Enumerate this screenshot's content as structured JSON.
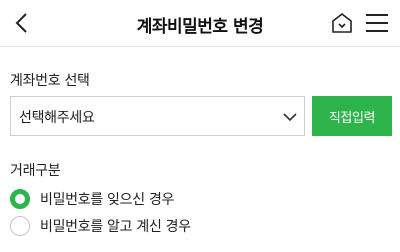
{
  "header": {
    "title": "계좌비밀번호 변경",
    "back_icon": "chevron-left-icon",
    "home_icon": "home-icon",
    "menu_icon": "hamburger-menu-icon"
  },
  "account": {
    "label": "계좌번호 선택",
    "select_value": "선택해주세요",
    "direct_button": "직접입력"
  },
  "transaction": {
    "label": "거래구분",
    "options": [
      {
        "label": "비밀번호를 잊으신 경우",
        "checked": true
      },
      {
        "label": "비밀번호를 알고 계신 경우",
        "checked": false
      }
    ]
  },
  "colors": {
    "accent": "#2db44a"
  }
}
